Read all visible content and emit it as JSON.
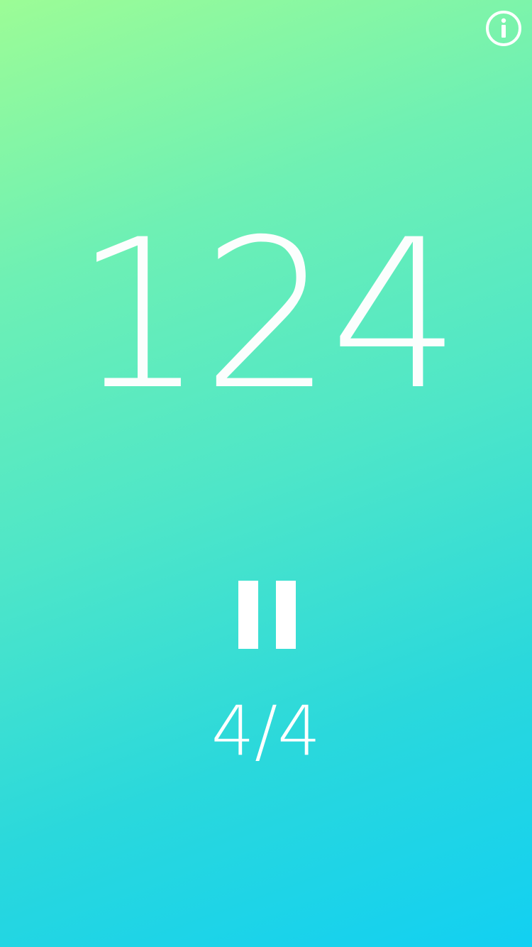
{
  "app": {
    "bpm": "124",
    "time_signature": "4/4",
    "playback_state": "playing"
  },
  "controls": {
    "info_icon": "info-circle-icon",
    "pause_icon": "pause-icon"
  },
  "theme": {
    "gradient_start": "#9cfc96",
    "gradient_end": "#12d0f2",
    "foreground": "#ffffff"
  }
}
